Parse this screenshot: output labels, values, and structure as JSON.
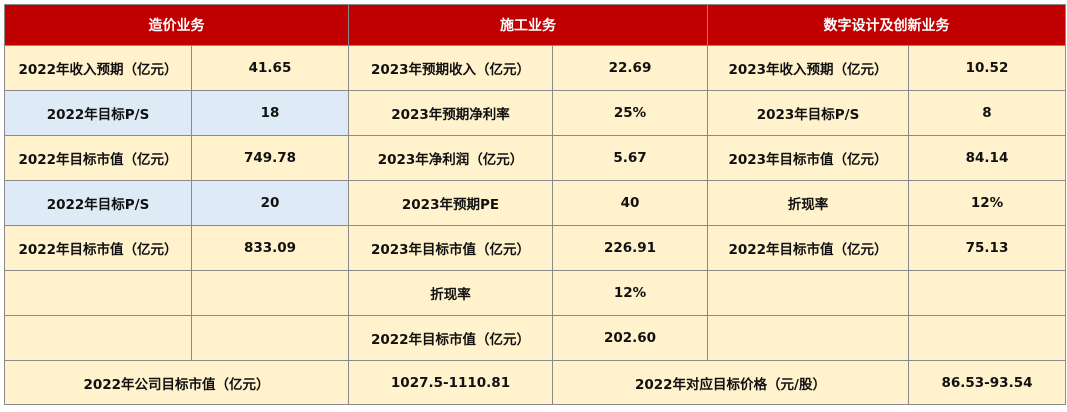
{
  "colors": {
    "header_bg": "#c00000",
    "header_text": "#ffffff",
    "cell_bg": "#fff2cc",
    "highlight_bg": "#deebf7",
    "border": "#8a8a8a"
  },
  "headers": [
    "造价业务",
    "施工业务",
    "数字设计及创新业务"
  ],
  "rows": [
    [
      "2022年收入预期（亿元）",
      "41.65",
      "2023年预期收入（亿元）",
      "22.69",
      "2023年收入预期（亿元）",
      "10.52"
    ],
    [
      "2022年目标P/S",
      "18",
      "2023年预期净利率",
      "25%",
      "2023年目标P/S",
      "8"
    ],
    [
      "2022年目标市值（亿元）",
      "749.78",
      "2023年净利润（亿元）",
      "5.67",
      "2023年目标市值（亿元）",
      "84.14"
    ],
    [
      "2022年目标P/S",
      "20",
      "2023年预期PE",
      "40",
      "折现率",
      "12%"
    ],
    [
      "2022年目标市值（亿元）",
      "833.09",
      "2023年目标市值（亿元）",
      "226.91",
      "2022年目标市值（亿元）",
      "75.13"
    ],
    [
      "",
      "",
      "折现率",
      "12%",
      "",
      ""
    ],
    [
      "",
      "",
      "2022年目标市值（亿元）",
      "202.60",
      "",
      ""
    ]
  ],
  "highlight_rows": [
    1,
    3
  ],
  "summary": [
    "2022年公司目标市值（亿元）",
    "1027.5-1110.81",
    "2022年对应目标价格（元/股）",
    "86.53-93.54"
  ]
}
